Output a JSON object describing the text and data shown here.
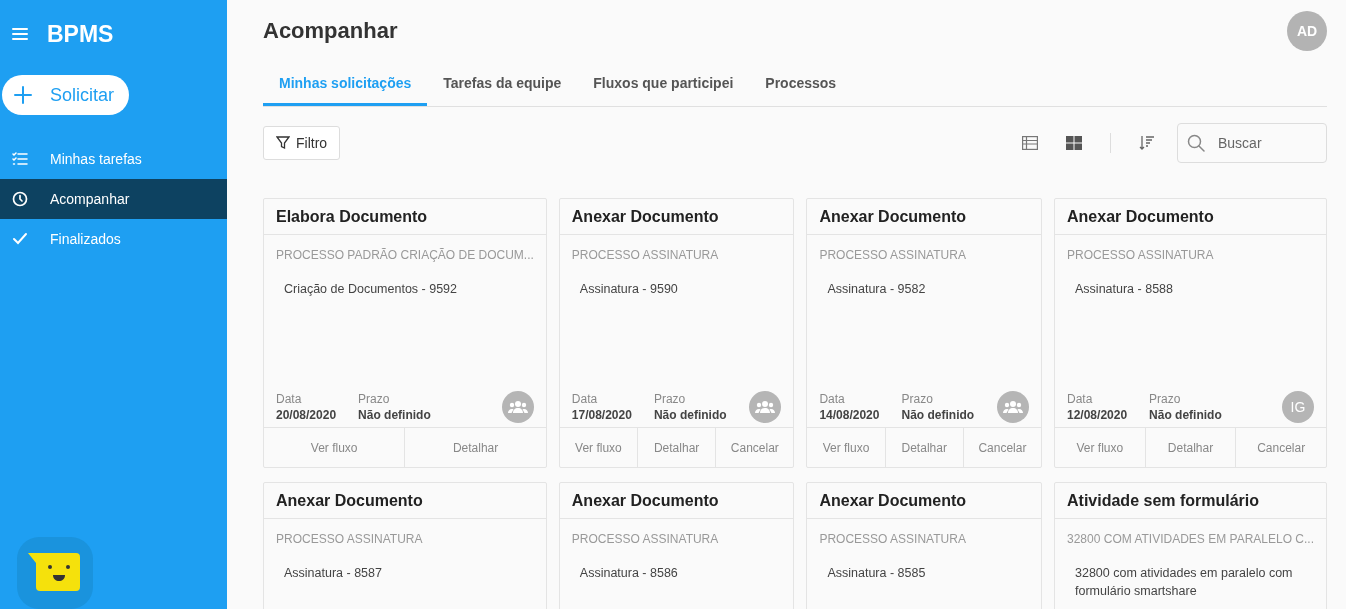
{
  "sidebar": {
    "brand": "BPMS",
    "request_button": "Solicitar",
    "items": [
      {
        "label": "Minhas tarefas",
        "selected": false
      },
      {
        "label": "Acompanhar",
        "selected": true
      },
      {
        "label": "Finalizados",
        "selected": false
      }
    ]
  },
  "header": {
    "title": "Acompanhar",
    "avatar": "AD"
  },
  "tabs": [
    {
      "label": "Minhas solicitações",
      "selected": true
    },
    {
      "label": "Tarefas da equipe",
      "selected": false
    },
    {
      "label": "Fluxos que participei",
      "selected": false
    },
    {
      "label": "Processos",
      "selected": false
    }
  ],
  "toolbar": {
    "filter": "Filtro",
    "views": [
      {
        "selected": false
      },
      {
        "selected": true
      }
    ],
    "search": {
      "placeholder": "Buscar"
    }
  },
  "cards": [
    {
      "title": "Elabora Documento",
      "process": "PROCESSO PADRÃO CRIAÇÃO DE DOCUM...",
      "description": "Criação de Documentos - 9592",
      "date_label": "Data",
      "date": "20/08/2020",
      "deadline_label": "Prazo",
      "deadline": "Não definido",
      "assignee": {
        "kind": "group"
      },
      "actions": [
        "Ver fluxo",
        "Detalhar"
      ]
    },
    {
      "title": "Anexar Documento",
      "process": "PROCESSO ASSINATURA",
      "description": "Assinatura - 9590",
      "date_label": "Data",
      "date": "17/08/2020",
      "deadline_label": "Prazo",
      "deadline": "Não definido",
      "assignee": {
        "kind": "group"
      },
      "actions": [
        "Ver fluxo",
        "Detalhar",
        "Cancelar"
      ]
    },
    {
      "title": "Anexar Documento",
      "process": "PROCESSO ASSINATURA",
      "description": "Assinatura - 9582",
      "date_label": "Data",
      "date": "14/08/2020",
      "deadline_label": "Prazo",
      "deadline": "Não definido",
      "assignee": {
        "kind": "group"
      },
      "actions": [
        "Ver fluxo",
        "Detalhar",
        "Cancelar"
      ]
    },
    {
      "title": "Anexar Documento",
      "process": "PROCESSO ASSINATURA",
      "description": "Assinatura - 8588",
      "date_label": "Data",
      "date": "12/08/2020",
      "deadline_label": "Prazo",
      "deadline": "Não definido",
      "assignee": {
        "kind": "initials",
        "initials": "IG"
      },
      "actions": [
        "Ver fluxo",
        "Detalhar",
        "Cancelar"
      ]
    },
    {
      "title": "Anexar Documento",
      "process": "PROCESSO ASSINATURA",
      "description": "Assinatura - 8587"
    },
    {
      "title": "Anexar Documento",
      "process": "PROCESSO ASSINATURA",
      "description": "Assinatura - 8586"
    },
    {
      "title": "Anexar Documento",
      "process": "PROCESSO ASSINATURA",
      "description": "Assinatura - 8585"
    },
    {
      "title": "Atividade sem formulário",
      "process": "32800 COM ATIVIDADES EM PARALELO C...",
      "description": "32800 com atividades em paralelo com formulário smartshare"
    }
  ]
}
